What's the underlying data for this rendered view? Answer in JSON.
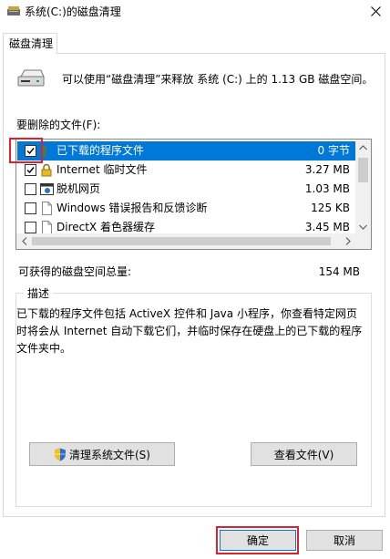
{
  "window": {
    "title": "系统(C:)的磁盘清理"
  },
  "tabs": [
    {
      "label": "磁盘清理"
    }
  ],
  "intro": {
    "text": "可以使用“磁盘清理”来释放 系统 (C:) 上的 1.13 GB 磁盘空间。"
  },
  "files_section": {
    "label": "要删除的文件(F):",
    "items": [
      {
        "name": "已下载的程序文件",
        "size": "0 字节",
        "checked": true,
        "selected": true
      },
      {
        "name": "Internet 临时文件",
        "size": "3.27 MB",
        "checked": true,
        "selected": false
      },
      {
        "name": "脱机网页",
        "size": "1.03 MB",
        "checked": false,
        "selected": false
      },
      {
        "name": "Windows 错误报告和反馈诊断",
        "size": "125 KB",
        "checked": false,
        "selected": false
      },
      {
        "name": "DirectX 着色器缓存",
        "size": "3.45 MB",
        "checked": false,
        "selected": false
      }
    ]
  },
  "total": {
    "label": "可获得的磁盘空间总量:",
    "value": "154 MB"
  },
  "description": {
    "legend": "描述",
    "text": "已下载的程序文件包括 ActiveX 控件和 Java 小程序，你查看特定网页时将会从 Internet 自动下载它们，并临时保存在硬盘上的已下载的程序文件夹中。"
  },
  "buttons": {
    "clean_system": "清理系统文件(S)",
    "view_files": "查看文件(V)",
    "ok": "确定",
    "cancel": "取消"
  },
  "colors": {
    "selection": "#0078d7",
    "highlight": "#e0202a"
  }
}
